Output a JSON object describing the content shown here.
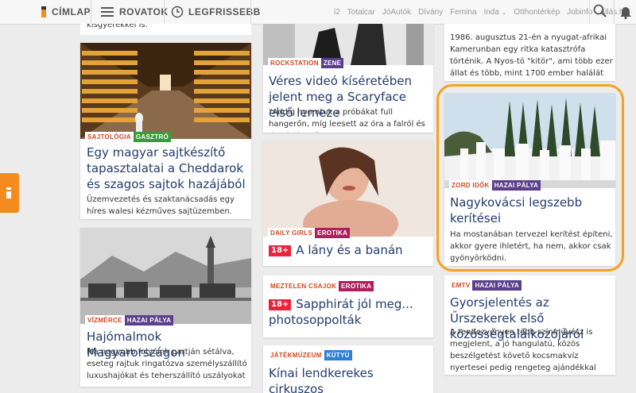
{
  "nav": {
    "home": "CÍMLAP",
    "sections": "ROVATOK",
    "latest": "LEGFRISSEBB",
    "sites": [
      "i2",
      "Totalcar",
      "JóAutók",
      "Dívány",
      "Femina",
      "Inda",
      "Otthontérkép",
      "Jobinfo",
      "Állás.hu"
    ]
  },
  "cards": {
    "top_left": {
      "lead_tail": "kísgyerekkel is."
    },
    "rockstation": {
      "tag1": "ROCKSTATION",
      "tag2": "ZENE",
      "title": "Véres videó kíséretében jelent meg a Scaryface első lemeze",
      "lead": "\"Addig nyomtuk a próbákat full hangerőn, míg leesett az óra a falról és darabokra tört.\""
    },
    "top_right": {
      "lead": "1986. augusztus 21-én a nyugat-afrikai Kamerunban egy ritka katasztrófa történik. A Nyos-tó \"kitör\", ami több ezer állat és több, mint 1700 ember halálát okozza perceken belül."
    },
    "cheese": {
      "tag1": "SAJTOLÓGIA",
      "tag2": "GASZTRÓ",
      "title": "Egy magyar sajtkészítő tapasztalatai a Cheddarok és szagos sajtok hazájából",
      "lead": "Üzemvezetés és szaktanácsadás egy híres walesi kézműves sajtüzemben."
    },
    "dailygirls": {
      "tag1": "DAILY GIRLS",
      "tag2": "EROTIKA",
      "badge": "18+",
      "title": "A lány és a banán"
    },
    "fence": {
      "tag1": "ZORD IDŐK",
      "tag2": "HAZAI PÁLYA",
      "title": "Nagykovácsi legszebb kerítései",
      "lead": "Ha mostanában tervezel kerítést építeni, akkor gyere ihletért, ha nem, akkor csak gyönyörködni."
    },
    "mills": {
      "tag1": "VÍZMÉRCE",
      "tag2": "HAZAI PÁLYA",
      "title": "Hajómalmok Magyarországon",
      "lead": "Ma nagyobb folyóink partján sétálva, eseteg rajtuk ringatózva személyszállító luxushajókat és teherszállító uszályokat"
    },
    "meztelen": {
      "tag1": "MEZTELEN CSAJOK",
      "tag2": "EROTIKA",
      "badge": "18+",
      "title": "Sapphirát jól meg... photosoppolták"
    },
    "emtv": {
      "tag1": "EMTV",
      "tag2": "HAZAI PÁLYA",
      "title": "Gyorsjelentés az Űrszekerek első közösségtalálkozójáról",
      "lead": "A rendezvényen több színművész is megjelent, a jó hangulatú, közös beszélgetést követő kocsmakvíz nyertesei pedig rengeteg ajándékkal távoztak."
    },
    "jatek": {
      "tag1": "JÁTÉKMÚZEUM",
      "tag2": "KÜTYÜ",
      "title": "Kínai lendkerekes cirkuszos"
    }
  },
  "colors": {
    "accent": "#f58b1f",
    "title": "#233b6e",
    "purple": "#5b3f8c",
    "highlight": "#f5a21e"
  }
}
